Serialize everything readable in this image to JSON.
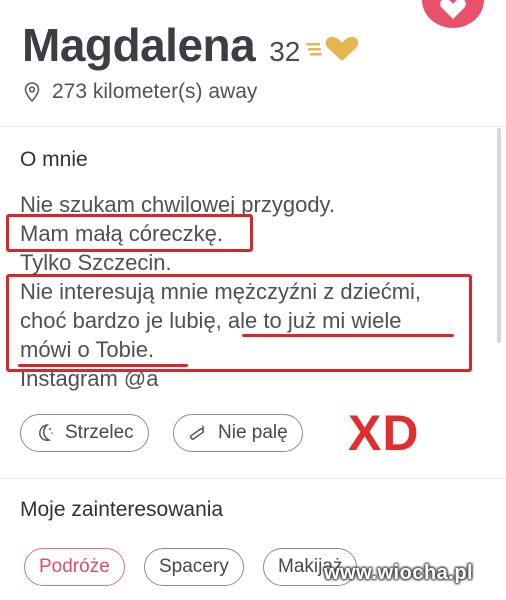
{
  "profile": {
    "name": "Magdalena",
    "age": "32",
    "distance": "273 kilometer(s) away"
  },
  "about": {
    "title": "O mnie",
    "lines": [
      "Nie szukam chwilowej przygody.",
      "Mam małą córeczkę.",
      "Tylko Szczecin.",
      "Nie interesują mnie mężczyźni z dziećmi,",
      "choć bardzo je lubię, ale to już mi wiele",
      "mówi o Tobie.",
      "Instagram @a"
    ]
  },
  "badges": [
    {
      "label": "Strzelec",
      "icon": "moon-zodiac-icon"
    },
    {
      "label": "Nie palę",
      "icon": "no-smoking-icon"
    }
  ],
  "interests": {
    "title": "Moje zainteresowania",
    "items": [
      "Podróże",
      "Spacery",
      "Makijaż"
    ]
  },
  "overlay": {
    "xd_text": "XD",
    "watermark": "www.wiocha.pl"
  },
  "colors": {
    "highlight": "#d9262c",
    "accent": "#e8526a",
    "gold": "#e3b64f"
  }
}
